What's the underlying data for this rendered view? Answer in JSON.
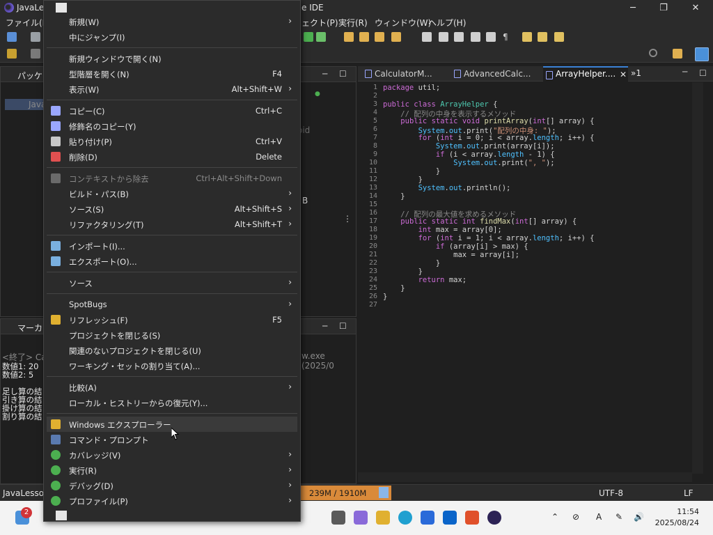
{
  "window": {
    "title_left": "JavaLes",
    "title_right": "e IDE",
    "minimize": "─",
    "maximize": "❐",
    "close": "✕"
  },
  "menubar": {
    "file": "ファイル(F)",
    "project": "ェクト(P)",
    "run": "実行(R)",
    "window": "ウィンドウ(W)",
    "help": "ヘルプ(H)"
  },
  "left_panel": {
    "package_tab": "パッケー",
    "project_node": "Java",
    "marker_tab": "マーカー",
    "console_terminated": "<終了> Cal",
    "console_lines": [
      "数値1: 20",
      "数値2: 5",
      "",
      "足し算の結",
      "引き算の結",
      "掛け算の結",
      "割り算の結"
    ],
    "snippet_void": "oid",
    "snippet_exe": "w.exe  (2025/0",
    "snippet_b": "B"
  },
  "editor": {
    "tabs": [
      {
        "label": "CalculatorM...",
        "active": false
      },
      {
        "label": "AdvancedCalc...",
        "active": false
      },
      {
        "label": "ArrayHelper....",
        "active": true
      }
    ],
    "overflow_label": "»1",
    "lines": [
      {
        "n": "1",
        "text": "package util;"
      },
      {
        "n": "2",
        "text": ""
      },
      {
        "n": "3",
        "text": "public class ArrayHelper {"
      },
      {
        "n": "4",
        "text": "    // 配列の中身を表示するメソッド"
      },
      {
        "n": "5",
        "text": "    public static void printArray(int[] array) {"
      },
      {
        "n": "6",
        "text": "        System.out.print(\"配列の中身: \");"
      },
      {
        "n": "7",
        "text": "        for (int i = 0; i < array.length; i++) {"
      },
      {
        "n": "8",
        "text": "            System.out.print(array[i]);"
      },
      {
        "n": "9",
        "text": "            if (i < array.length - 1) {"
      },
      {
        "n": "10",
        "text": "                System.out.print(\", \");"
      },
      {
        "n": "11",
        "text": "            }"
      },
      {
        "n": "12",
        "text": "        }"
      },
      {
        "n": "13",
        "text": "        System.out.println();"
      },
      {
        "n": "14",
        "text": "    }"
      },
      {
        "n": "15",
        "text": ""
      },
      {
        "n": "16",
        "text": "    // 配列の最大値を求めるメソッド"
      },
      {
        "n": "17",
        "text": "    public static int findMax(int[] array) {"
      },
      {
        "n": "18",
        "text": "        int max = array[0];"
      },
      {
        "n": "19",
        "text": "        for (int i = 1; i < array.length; i++) {"
      },
      {
        "n": "20",
        "text": "            if (array[i] > max) {"
      },
      {
        "n": "21",
        "text": "                max = array[i];"
      },
      {
        "n": "22",
        "text": "            }"
      },
      {
        "n": "23",
        "text": "        }"
      },
      {
        "n": "24",
        "text": "        return max;"
      },
      {
        "n": "25",
        "text": "    }"
      },
      {
        "n": "26",
        "text": "}"
      },
      {
        "n": "27",
        "text": ""
      }
    ]
  },
  "statusbar": {
    "project": "JavaLesson",
    "memory": "239M / 1910M",
    "encoding": "UTF-8",
    "line_ending": "LF"
  },
  "taskbar": {
    "badge": "2",
    "time": "11:54",
    "date": "2025/08/24"
  },
  "context_menu": {
    "items": [
      {
        "label": "新規(W)",
        "accel": "",
        "submenu": true
      },
      {
        "label": "中にジャンプ(I)",
        "accel": "",
        "submenu": false
      },
      {
        "sep": true
      },
      {
        "label": "新規ウィンドウで開く(N)",
        "accel": "",
        "submenu": false
      },
      {
        "label": "型階層を開く(N)",
        "accel": "F4",
        "submenu": false
      },
      {
        "label": "表示(W)",
        "accel": "Alt+Shift+W",
        "submenu": true
      },
      {
        "sep": true
      },
      {
        "label": "コピー(C)",
        "accel": "Ctrl+C",
        "submenu": false,
        "icon": "copy"
      },
      {
        "label": "修飾名のコピー(Y)",
        "accel": "",
        "submenu": false,
        "icon": "copy-qualified"
      },
      {
        "label": "貼り付け(P)",
        "accel": "Ctrl+V",
        "submenu": false,
        "icon": "paste"
      },
      {
        "label": "削除(D)",
        "accel": "Delete",
        "submenu": false,
        "icon": "delete"
      },
      {
        "sep": true
      },
      {
        "label": "コンテキストから除去",
        "accel": "Ctrl+Alt+Shift+Down",
        "submenu": false,
        "disabled": true,
        "icon": "remove-context"
      },
      {
        "label": "ビルド・パス(B)",
        "accel": "",
        "submenu": true
      },
      {
        "label": "ソース(S)",
        "accel": "Alt+Shift+S",
        "submenu": true
      },
      {
        "label": "リファクタリング(T)",
        "accel": "Alt+Shift+T",
        "submenu": true
      },
      {
        "sep": true
      },
      {
        "label": "インポート(I)...",
        "accel": "",
        "submenu": false,
        "icon": "import"
      },
      {
        "label": "エクスポート(O)...",
        "accel": "",
        "submenu": false,
        "icon": "export"
      },
      {
        "sep": true
      },
      {
        "label": "ソース",
        "accel": "",
        "submenu": true
      },
      {
        "sep": true
      },
      {
        "label": "SpotBugs",
        "accel": "",
        "submenu": true
      },
      {
        "label": "リフレッシュ(F)",
        "accel": "F5",
        "submenu": false,
        "icon": "refresh"
      },
      {
        "label": "プロジェクトを閉じる(S)",
        "accel": "",
        "submenu": false
      },
      {
        "label": "関連のないプロジェクトを閉じる(U)",
        "accel": "",
        "submenu": false
      },
      {
        "label": "ワーキング・セットの割り当て(A)...",
        "accel": "",
        "submenu": false
      },
      {
        "sep": true
      },
      {
        "label": "比較(A)",
        "accel": "",
        "submenu": true
      },
      {
        "label": "ローカル・ヒストリーからの復元(Y)...",
        "accel": "",
        "submenu": false
      },
      {
        "sep": true
      },
      {
        "label": "Windows エクスプローラー",
        "accel": "",
        "submenu": false,
        "hover": true,
        "icon": "explorer"
      },
      {
        "label": "コマンド・プロンプト",
        "accel": "",
        "submenu": false,
        "icon": "terminal"
      },
      {
        "label": "カバレッジ(V)",
        "accel": "",
        "submenu": true,
        "icon": "coverage"
      },
      {
        "label": "実行(R)",
        "accel": "",
        "submenu": true,
        "icon": "run"
      },
      {
        "label": "デバッグ(D)",
        "accel": "",
        "submenu": true,
        "icon": "debug"
      },
      {
        "label": "プロファイル(P)",
        "accel": "",
        "submenu": true,
        "icon": "profile"
      }
    ]
  },
  "colors": {
    "bg": "#1f1f1f",
    "panel": "#2b2b2b",
    "accent": "#3b82d6",
    "keyword": "#cc6bd6",
    "string": "#ce9178"
  }
}
